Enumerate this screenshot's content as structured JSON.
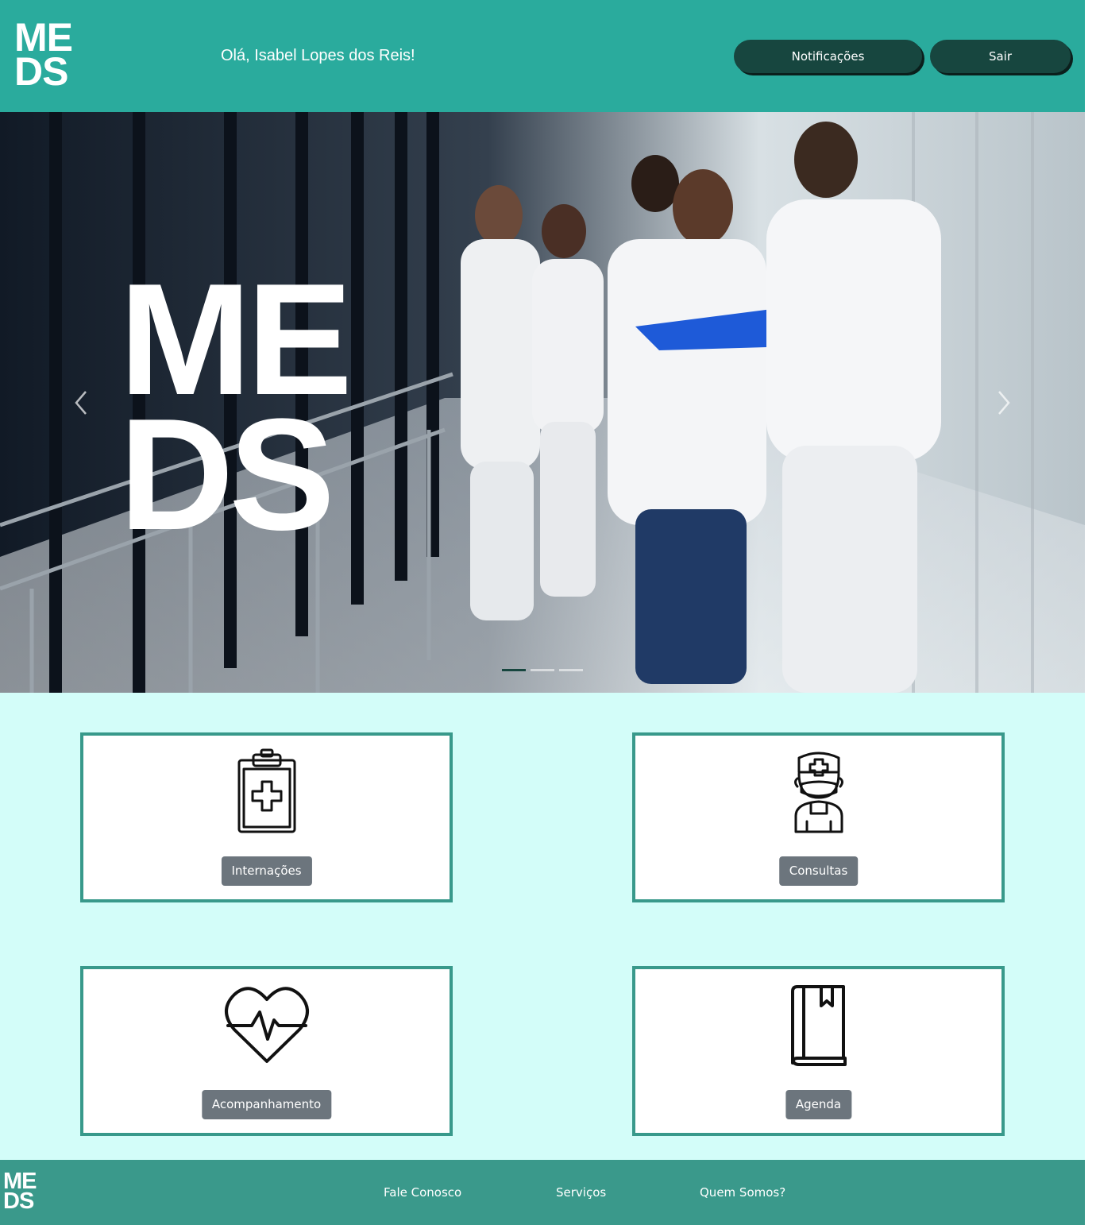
{
  "header": {
    "logo_line1": "ME",
    "logo_line2": "DS",
    "greeting": "Olá, Isabel Lopes dos Reis!",
    "notifications_label": "Notificações",
    "logout_label": "Sair"
  },
  "hero": {
    "overlay_line1": "ME",
    "overlay_line2": "DS",
    "prev_icon": "chevron-left-icon",
    "next_icon": "chevron-right-icon",
    "indicator_count": 3,
    "active_indicator": 1
  },
  "cards": [
    {
      "label": "Internações",
      "icon": "clipboard-medical-icon"
    },
    {
      "label": "Consultas",
      "icon": "doctor-icon"
    },
    {
      "label": "Acompanhamento",
      "icon": "heartbeat-icon"
    },
    {
      "label": "Agenda",
      "icon": "book-icon"
    }
  ],
  "footer": {
    "logo_line1": "ME",
    "logo_line2": "DS",
    "links": [
      "Fale Conosco",
      "Serviços",
      "Quem Somos?"
    ]
  },
  "colors": {
    "header_bg": "#2aab9d",
    "button_dark": "#17463f",
    "main_bg": "#d3fdf9",
    "card_border": "#38998b",
    "card_button": "#6c757d",
    "footer_bg": "#3a998b"
  }
}
